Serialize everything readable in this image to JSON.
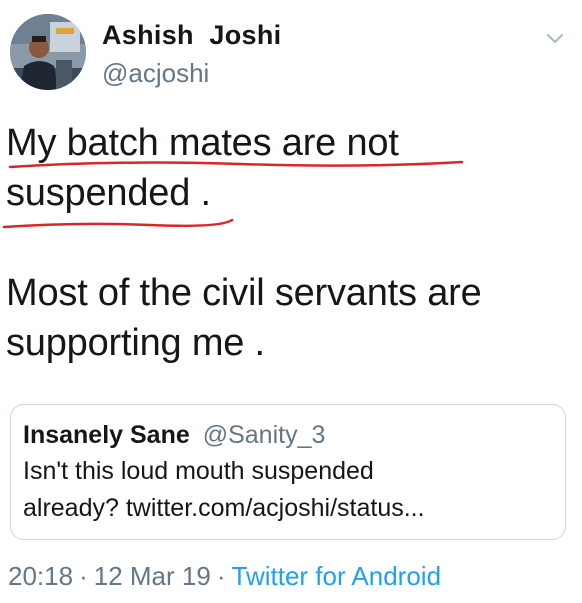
{
  "author": {
    "name": "Ashish  Joshi",
    "handle": "@acjoshi"
  },
  "tweet": {
    "lines": [
      "My batch mates are not",
      "suspended .",
      "Most of the civil servants are",
      "supporting me ."
    ]
  },
  "quoted_tweet": {
    "name": "Insanely Sane",
    "handle": "@Sanity_3",
    "lines": [
      "Isn't this loud mouth suspended",
      "already? twitter.com/acjoshi/status..."
    ]
  },
  "meta": {
    "time": "20:18",
    "date": "12 Mar 19",
    "separator": "·",
    "source": "Twitter for Android"
  },
  "icons": {
    "menu": "chevron-down-icon",
    "avatar": "avatar-photo"
  },
  "colors": {
    "text": "#14171a",
    "secondary": "#657786",
    "link": "#1da1f2",
    "annotation": "#d9262b",
    "border": "#ccd6dd"
  }
}
